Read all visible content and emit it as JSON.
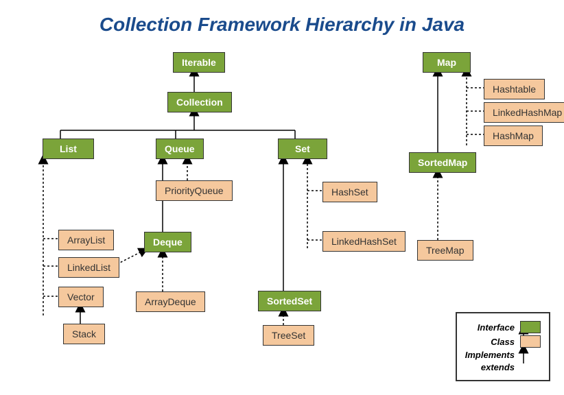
{
  "title": "Collection Framework Hierarchy in Java",
  "nodes": {
    "iterable": "Iterable",
    "collection": "Collection",
    "list": "List",
    "queue": "Queue",
    "set": "Set",
    "deque": "Deque",
    "sortedset": "SortedSet",
    "map": "Map",
    "sortedmap": "SortedMap",
    "arraylist": "ArrayList",
    "linkedlist": "LinkedList",
    "vector": "Vector",
    "stack": "Stack",
    "priorityqueue": "PriorityQueue",
    "arraydeque": "ArrayDeque",
    "hashset": "HashSet",
    "linkedhashset": "LinkedHashSet",
    "treeset": "TreeSet",
    "hashtable": "Hashtable",
    "linkedhashmap": "LinkedHashMap",
    "hashmap": "HashMap",
    "treemap": "TreeMap"
  },
  "legend": {
    "interface": "Interface",
    "class": "Class",
    "implements": "Implements",
    "extends": "extends"
  }
}
